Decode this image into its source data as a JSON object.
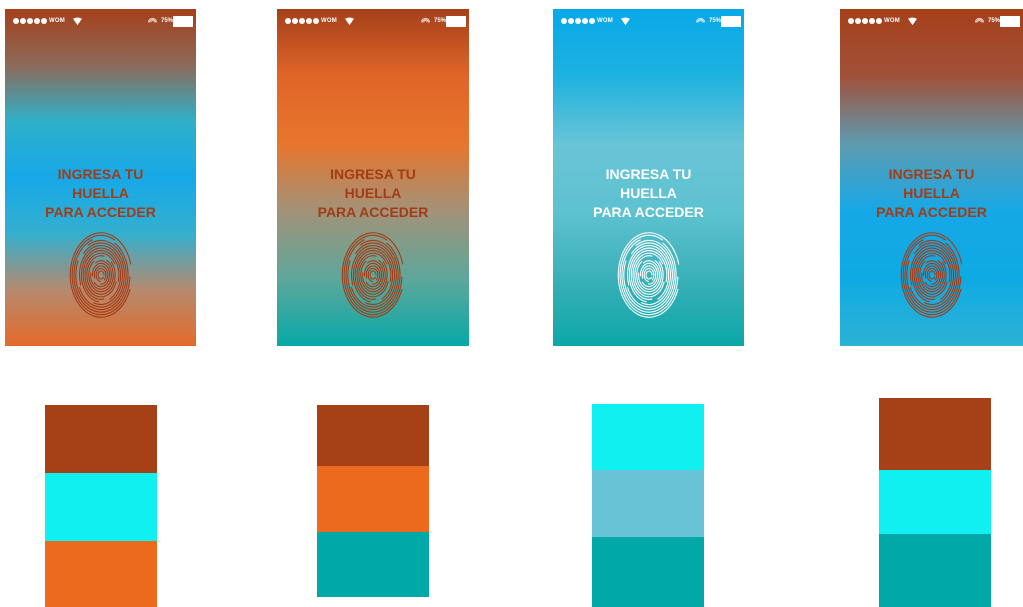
{
  "screens": [
    {
      "carrier": "WOM",
      "battery": "75%",
      "headline": [
        "INGRESA TU",
        "HUELLA",
        "PARA ACCEDER"
      ],
      "text_color": "#A33C16",
      "fingerprint_color": "#A33C16",
      "gradient": [
        "#A5401B",
        "#8D6A5A",
        "#2FB0C8",
        "#16A8E8",
        "#34AFCF",
        "#B58A6E",
        "#E46A2B"
      ]
    },
    {
      "carrier": "WOM",
      "battery": "75%",
      "headline": [
        "INGRESA TU",
        "HUELLA",
        "PARA ACCEDER"
      ],
      "text_color": "#A33C16",
      "fingerprint_color": "#A33C16",
      "gradient": [
        "#A5401B",
        "#E06528",
        "#E7752C",
        "#A29279",
        "#5EA79B",
        "#07A9A7"
      ]
    },
    {
      "carrier": "WOM",
      "battery": "75%",
      "headline": [
        "INGRESA TU",
        "HUELLA",
        "PARA ACCEDER"
      ],
      "text_color": "#FFFFFF",
      "fingerprint_color": "#FFFFFF",
      "gradient": [
        "#08A8E8",
        "#1DB2E0",
        "#68C4D6",
        "#5EC2D0",
        "#3AB0B8",
        "#0BA8A8"
      ]
    },
    {
      "carrier": "WOM",
      "battery": "75%",
      "headline": [
        "INGRESA TU",
        "HUELLA",
        "PARA ACCEDER"
      ],
      "text_color": "#A33C16",
      "fingerprint_color": "#A33C16",
      "gradient": [
        "#A6401A",
        "#A0513A",
        "#5F9BB0",
        "#16A8E6",
        "#0EAAE4",
        "#2CB2D4"
      ]
    }
  ],
  "palettes": [
    [
      "#A64017",
      "#10F0F0",
      "#EC6A1D"
    ],
    [
      "#A64017",
      "#EC6A1D",
      "#00A8A8"
    ],
    [
      "#10F0F0",
      "#67C3D5",
      "#00A8A8"
    ],
    [
      "#A64017",
      "#10F0F0",
      "#00A8A8"
    ]
  ]
}
